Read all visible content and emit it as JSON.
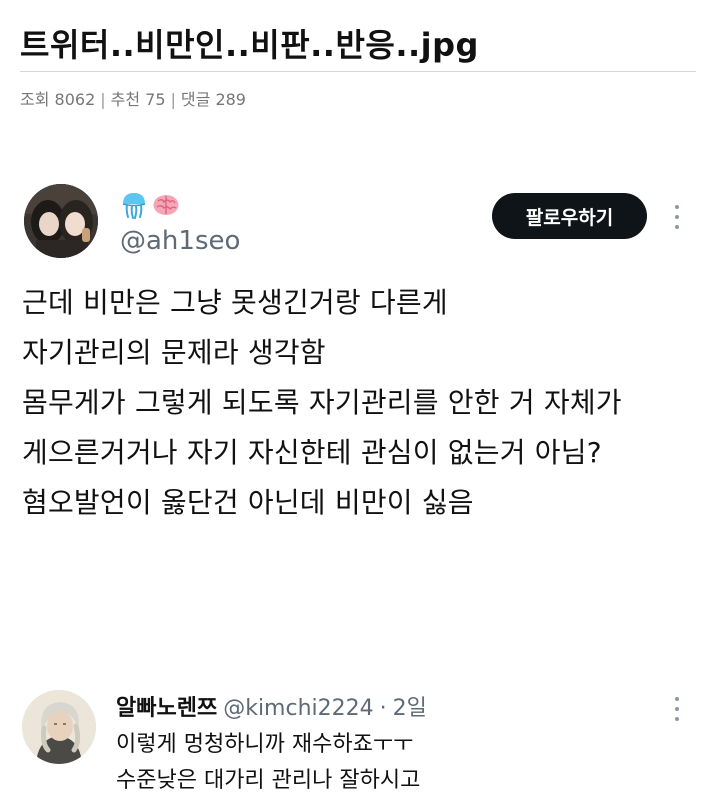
{
  "post": {
    "title": "트위터..비만인..비판..반응..jpg",
    "meta": {
      "views": "조회 8062",
      "recommend": "추천 75",
      "comments": "댓글 289",
      "separator": "|"
    }
  },
  "tweet": {
    "avatar_icon": "profile-photo-two-people",
    "emojis": [
      "jellyfish-icon",
      "brain-icon"
    ],
    "handle": "@ah1seo",
    "follow_label": "팔로우하기",
    "lines": [
      "근데 비만은 그냥 못생긴거랑 다른게",
      "자기관리의 문제라 생각함",
      "몸무게가 그렇게 되도록 자기관리를 안한 거 자체가",
      "게으른거거나 자기 자신한테 관심이 없는거 아님?",
      "혐오발언이 옳단건 아닌데 비만이 싫음"
    ]
  },
  "reply": {
    "avatar_icon": "profile-photo-illustration",
    "name": "알빠노렌쯔",
    "handle": "@kimchi2224",
    "dot": "·",
    "age": "2일",
    "lines": [
      "이렇게 멍청하니까 재수하죠ㅜㅜ",
      "수준낮은 대가리 관리나 잘하시고"
    ]
  },
  "colors": {
    "follow_button_bg": "#0f1419",
    "handle_gray": "#5e6a75",
    "meta_gray": "#777777"
  }
}
